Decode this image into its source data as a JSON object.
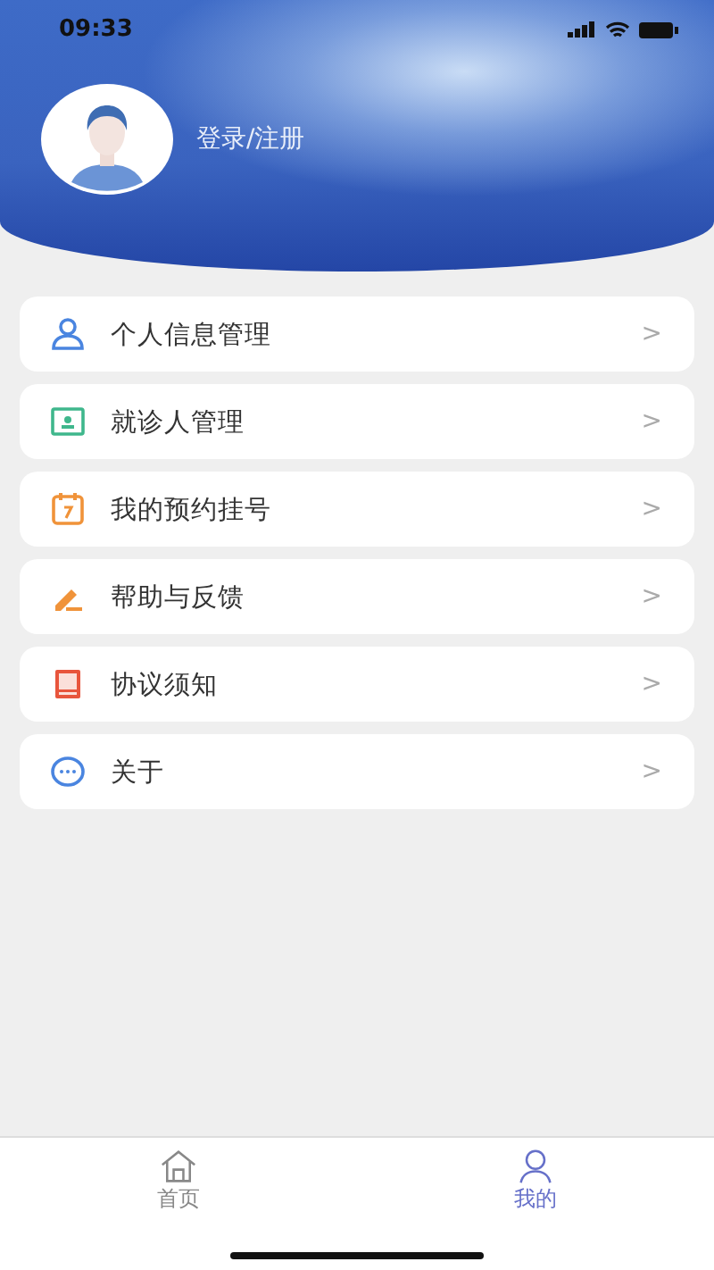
{
  "status_bar": {
    "time": "09:33"
  },
  "profile": {
    "login_label": "登录/注册"
  },
  "menu": [
    {
      "kind": "person",
      "label": "个人信息管理",
      "chevron": ">"
    },
    {
      "kind": "card",
      "label": "就诊人管理",
      "chevron": ">"
    },
    {
      "kind": "calendar",
      "label": "我的预约挂号",
      "chevron": ">"
    },
    {
      "kind": "pen",
      "label": "帮助与反馈",
      "chevron": ">"
    },
    {
      "kind": "book",
      "label": "协议须知",
      "chevron": ">"
    },
    {
      "kind": "chat",
      "label": "关于",
      "chevron": ">"
    }
  ],
  "tabs": [
    {
      "kind": "home",
      "label": "首页",
      "selected": false
    },
    {
      "kind": "user",
      "label": "我的",
      "selected": true
    }
  ]
}
